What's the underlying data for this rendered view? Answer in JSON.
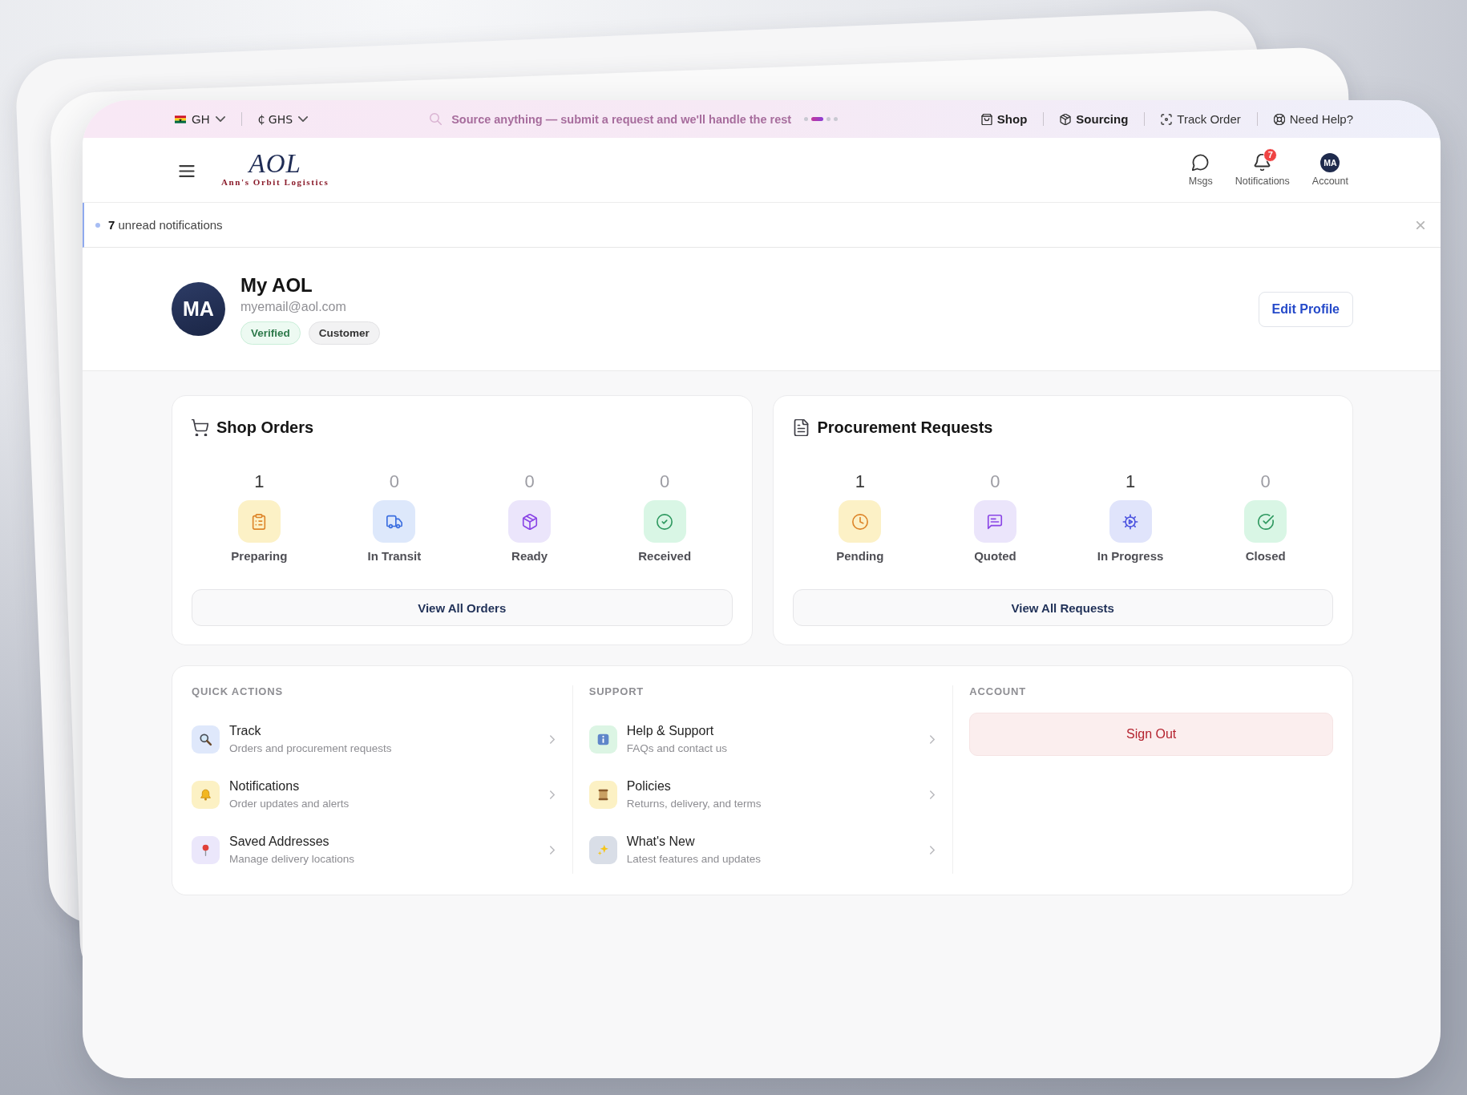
{
  "top_bar": {
    "region": {
      "label": "GH"
    },
    "currency": {
      "label": "₵ GHS"
    },
    "ticker": {
      "text": "Source anything — submit a request and we'll handle the rest",
      "dots": [
        {
          "selected": false
        },
        {
          "selected": true
        },
        {
          "selected": false
        },
        {
          "selected": false
        }
      ]
    },
    "links": [
      {
        "label": "Shop",
        "kind": "shop",
        "emphasized": true
      },
      {
        "label": "Sourcing",
        "kind": "sourcing",
        "emphasized": true
      },
      {
        "label": "Track Order",
        "kind": "track",
        "emphasized": false
      },
      {
        "label": "Need Help?",
        "kind": "help",
        "emphasized": false
      }
    ]
  },
  "header": {
    "logo": {
      "mark": "AOL",
      "tagline": "Ann's Orbit Logistics"
    },
    "actions": [
      {
        "kind": "messages",
        "label": "Msgs"
      },
      {
        "kind": "notifications",
        "label": "Notifications",
        "badge": "7"
      },
      {
        "kind": "account",
        "label": "Account",
        "initials": "MA"
      }
    ]
  },
  "notice": {
    "text": "**7** unread notifications"
  },
  "profile": {
    "initials": "MA",
    "name": "My AOL",
    "email": "myemail@aol.com",
    "tags": [
      {
        "label": "Verified",
        "kind": "verified"
      },
      {
        "label": "Customer",
        "kind": "role"
      }
    ],
    "edit_button": "Edit Profile"
  },
  "panels": [
    {
      "title": "Shop Orders",
      "kind": "cart",
      "stats": [
        {
          "count": "1",
          "label": "Preparing",
          "kind": "preparing",
          "dimmed": false
        },
        {
          "count": "0",
          "label": "In Transit",
          "kind": "transit",
          "dimmed": true
        },
        {
          "count": "0",
          "label": "Ready",
          "kind": "ready",
          "dimmed": true
        },
        {
          "count": "0",
          "label": "Received",
          "kind": "received",
          "dimmed": true
        }
      ],
      "button": "View All Orders"
    },
    {
      "title": "Procurement Requests",
      "kind": "document",
      "stats": [
        {
          "count": "1",
          "label": "Pending",
          "kind": "pending",
          "dimmed": false
        },
        {
          "count": "0",
          "label": "Quoted",
          "kind": "quoted",
          "dimmed": true
        },
        {
          "count": "1",
          "label": "In Progress",
          "kind": "progress",
          "dimmed": false
        },
        {
          "count": "0",
          "label": "Closed",
          "kind": "closed",
          "dimmed": true
        }
      ],
      "button": "View All Requests"
    }
  ],
  "quick_links": {
    "sections": [
      {
        "heading": "QUICK ACTIONS",
        "items": [
          {
            "title": "Track",
            "subtitle": "Orders and procurement requests",
            "kind": "search"
          },
          {
            "title": "Notifications",
            "subtitle": "Order updates and alerts",
            "kind": "alerts"
          },
          {
            "title": "Saved Addresses",
            "subtitle": "Manage delivery locations",
            "kind": "address"
          }
        ]
      },
      {
        "heading": "SUPPORT",
        "items": [
          {
            "title": "Help & Support",
            "subtitle": "FAQs and contact us",
            "kind": "help"
          },
          {
            "title": "Policies",
            "subtitle": "Returns, delivery, and terms",
            "kind": "policy"
          },
          {
            "title": "What's New",
            "subtitle": "Latest features and updates",
            "kind": "news"
          }
        ]
      },
      {
        "heading": "ACCOUNT",
        "button": "Sign Out"
      }
    ]
  }
}
